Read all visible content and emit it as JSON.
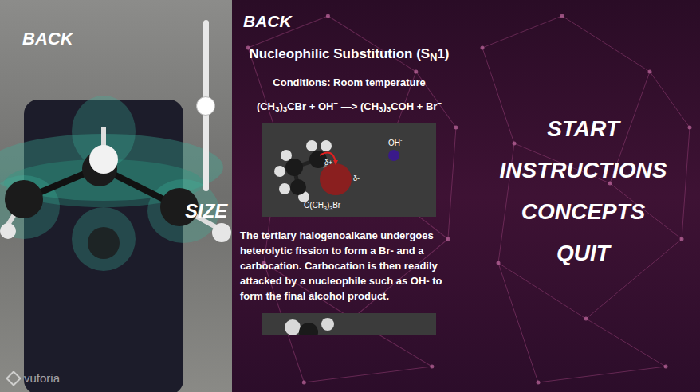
{
  "ar_view": {
    "back": "BACK",
    "size_label": "SIZE",
    "slider": {
      "level": 0.5
    },
    "watermark": "vuforia"
  },
  "concepts": {
    "back": "BACK",
    "title": [
      {
        "text": "Nucleophilic Substitution (S",
        "kind": "normal"
      },
      {
        "text": "N",
        "kind": "sub"
      },
      {
        "text": "1)",
        "kind": "normal"
      }
    ],
    "conditions": "Conditions: Room temperature",
    "equation": [
      {
        "text": "(CH",
        "kind": "normal"
      },
      {
        "text": "3",
        "kind": "sub"
      },
      {
        "text": ")",
        "kind": "normal"
      },
      {
        "text": "3",
        "kind": "sub"
      },
      {
        "text": "CBr + OH",
        "kind": "normal"
      },
      {
        "text": "−",
        "kind": "sup"
      },
      {
        "text": " —> (CH",
        "kind": "normal"
      },
      {
        "text": "3",
        "kind": "sub"
      },
      {
        "text": ")",
        "kind": "normal"
      },
      {
        "text": "3",
        "kind": "sub"
      },
      {
        "text": "COH + Br",
        "kind": "normal"
      },
      {
        "text": "−",
        "kind": "sup"
      }
    ],
    "figure": {
      "charge_carbon": "δ+",
      "charge_bromine": "δ-",
      "nucleophile": [
        {
          "text": "OH",
          "kind": "normal"
        },
        {
          "text": "-",
          "kind": "sup"
        }
      ],
      "caption": [
        {
          "text": "C(CH",
          "kind": "normal"
        },
        {
          "text": "3",
          "kind": "sub"
        },
        {
          "text": ")",
          "kind": "normal"
        },
        {
          "text": "3",
          "kind": "sub"
        },
        {
          "text": "Br",
          "kind": "normal"
        }
      ]
    },
    "paragraph": "The tertiary halogenoalkane undergoes heterolytic fission to form a Br- and a carbocation. Carbocation is then readily attacked by a nucleophile such as OH- to form the final alcohol product."
  },
  "menu": {
    "items": [
      "START",
      "INSTRUCTIONS",
      "CONCEPTS",
      "QUIT"
    ]
  }
}
